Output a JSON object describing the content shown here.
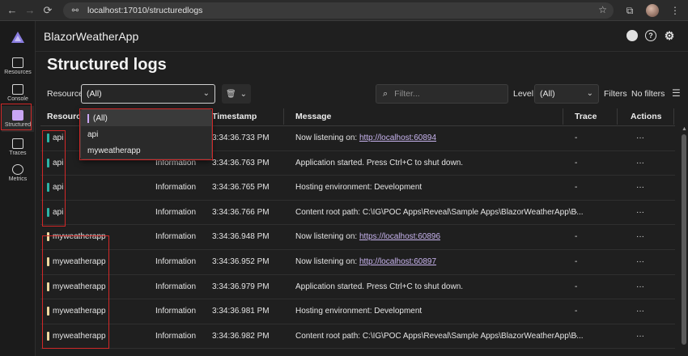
{
  "browser": {
    "url": "localhost:17010/structuredlogs",
    "back_icon": "←",
    "forward_icon": "→",
    "reload_icon": "⟳",
    "star_icon": "☆",
    "extensions_icon": "⧉",
    "menu_icon": "⋮"
  },
  "nav": {
    "items": [
      {
        "label": "Resources"
      },
      {
        "label": "Console"
      },
      {
        "label": "Structured"
      },
      {
        "label": "Traces"
      },
      {
        "label": "Metrics"
      }
    ]
  },
  "app": {
    "title": "BlazorWeatherApp",
    "help_icon": "?",
    "settings_icon": "⚙"
  },
  "page": {
    "title": "Structured logs"
  },
  "filters": {
    "resource_label": "Resource",
    "resource_value": "(All)",
    "search_placeholder": "Filter...",
    "level_label": "Level",
    "level_value": "(All)",
    "filters_label": "Filters",
    "no_filters": "No filters"
  },
  "dropdown": {
    "options": [
      "(All)",
      "api",
      "myweatherapp"
    ],
    "selected": "(All)"
  },
  "table": {
    "headers": {
      "resource": "Resource",
      "level": "",
      "timestamp": "Timestamp",
      "message": "Message",
      "trace": "Trace",
      "actions": "Actions"
    },
    "rows": [
      {
        "resource": "api",
        "level": "",
        "timestamp": "3:34:36.733 PM",
        "message_prefix": "Now listening on: ",
        "message_link": "http://localhost:60894",
        "trace": "-",
        "actions": "···"
      },
      {
        "resource": "api",
        "level": "Information",
        "timestamp": "3:34:36.763 PM",
        "message_prefix": "Application started. Press Ctrl+C to shut down.",
        "message_link": "",
        "trace": "-",
        "actions": "···"
      },
      {
        "resource": "api",
        "level": "Information",
        "timestamp": "3:34:36.765 PM",
        "message_prefix": "Hosting environment: Development",
        "message_link": "",
        "trace": "-",
        "actions": "···"
      },
      {
        "resource": "api",
        "level": "Information",
        "timestamp": "3:34:36.766 PM",
        "message_prefix": "Content root path: C:\\IG\\POC Apps\\Reveal\\Sample Apps\\BlazorWeatherApp\\B...",
        "message_link": "",
        "trace": "-",
        "actions": "···"
      },
      {
        "resource": "myweatherapp",
        "level": "Information",
        "timestamp": "3:34:36.948 PM",
        "message_prefix": "Now listening on: ",
        "message_link": "https://localhost:60896",
        "trace": "-",
        "actions": "···"
      },
      {
        "resource": "myweatherapp",
        "level": "Information",
        "timestamp": "3:34:36.952 PM",
        "message_prefix": "Now listening on: ",
        "message_link": "http://localhost:60897",
        "trace": "-",
        "actions": "···"
      },
      {
        "resource": "myweatherapp",
        "level": "Information",
        "timestamp": "3:34:36.979 PM",
        "message_prefix": "Application started. Press Ctrl+C to shut down.",
        "message_link": "",
        "trace": "-",
        "actions": "···"
      },
      {
        "resource": "myweatherapp",
        "level": "Information",
        "timestamp": "3:34:36.981 PM",
        "message_prefix": "Hosting environment: Development",
        "message_link": "",
        "trace": "-",
        "actions": "···"
      },
      {
        "resource": "myweatherapp",
        "level": "Information",
        "timestamp": "3:34:36.982 PM",
        "message_prefix": "Content root path: C:\\IG\\POC Apps\\Reveal\\Sample Apps\\BlazorWeatherApp\\B...",
        "message_link": "",
        "trace": "-",
        "actions": "···"
      }
    ]
  },
  "colors": {
    "api": "#2db3a6",
    "myweatherapp": "#f0d9a0",
    "accent": "#c9a6f5",
    "highlight": "#d02828"
  }
}
